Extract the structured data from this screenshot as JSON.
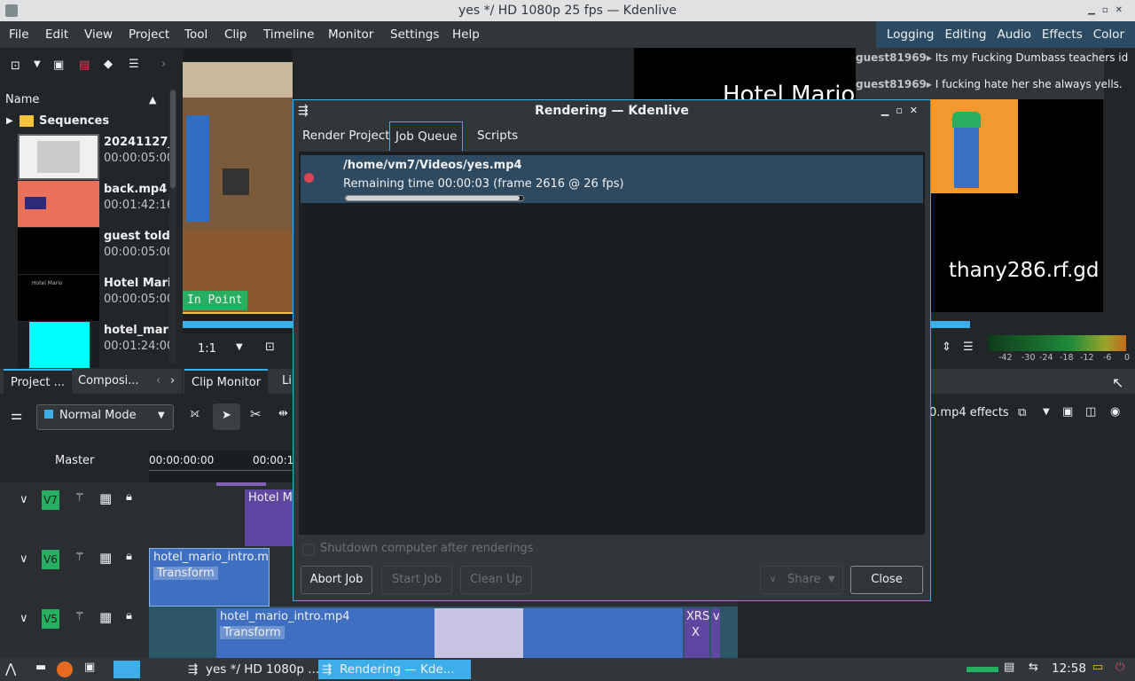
{
  "window": {
    "title": "yes */ HD 1080p 25 fps — Kdenlive"
  },
  "menu": {
    "items": [
      "File",
      "Edit",
      "View",
      "Project",
      "Tool",
      "Clip",
      "Timeline",
      "Monitor",
      "Settings",
      "Help"
    ],
    "layouts": [
      "Logging",
      "Editing",
      "Audio",
      "Effects",
      "Color"
    ]
  },
  "project_bin": {
    "column_header": "Name",
    "folder": "Sequences",
    "items": [
      {
        "name": "20241127_",
        "duration": "00:00:05:00"
      },
      {
        "name": "back.mp4",
        "duration": "00:01:42:16"
      },
      {
        "name": "guest told",
        "duration": "00:00:05:00"
      },
      {
        "name": "Hotel Mari",
        "duration": "00:00:05:00",
        "thumb_text": "Hotel Mario"
      },
      {
        "name": "hotel_mari",
        "duration": "00:01:24:00"
      }
    ],
    "tabs": [
      "Project ...",
      "Composi..."
    ]
  },
  "clip_monitor": {
    "overlay": "In Point",
    "zoom": "1:1",
    "tabs": [
      "Clip Monitor",
      "Li"
    ]
  },
  "project_monitor": {
    "title_text": "Hotel Mario",
    "watermark": "thany286.rf.gd",
    "chat": [
      {
        "user": "guest81969",
        "message": "Its my Fucking Dumbass teachers id"
      },
      {
        "user": "guest81969",
        "message": "I fucking hate her she always yells."
      }
    ]
  },
  "audio_meter": {
    "scale": [
      "-42",
      "-30",
      "-24",
      "-18",
      "-12",
      "-6",
      "0"
    ]
  },
  "effects_panel": {
    "title": "0.mp4 effects"
  },
  "timeline": {
    "mode": "Normal Mode",
    "master_label": "Master",
    "timecodes": [
      "00:00:00:00",
      "00:00:1"
    ],
    "tracks": [
      {
        "id": "V7",
        "clips": [
          {
            "title": "Hotel Ma"
          }
        ]
      },
      {
        "id": "V6",
        "clips": [
          {
            "title": "hotel_mario_intro.mp",
            "effect": "Transform"
          }
        ]
      },
      {
        "id": "V5",
        "clips": [
          {
            "title": "hotel_mario_intro.mp4",
            "effect": "Transform"
          },
          {
            "title": "XRS",
            "sub": "X"
          },
          {
            "title": "v"
          }
        ]
      }
    ]
  },
  "render_dialog": {
    "title": "Rendering — Kdenlive",
    "tabs": [
      "Render Project",
      "Job Queue",
      "Scripts"
    ],
    "active_tab": "Job Queue",
    "job": {
      "path": "/home/vm7/Videos/yes.mp4",
      "status": "Remaining time 00:00:03 (frame 2616 @ 26 fps)",
      "progress": 0.98
    },
    "shutdown_label": "Shutdown computer after renderings",
    "buttons": {
      "abort": "Abort Job",
      "start": "Start Job",
      "cleanup": "Clean Up",
      "share": "Share",
      "close": "Close"
    }
  },
  "taskbar": {
    "tasks": [
      "yes */ HD 1080p ...",
      "Rendering — Kde..."
    ],
    "clock": "12:58"
  },
  "colors": {
    "accent": "#3daee9",
    "job_highlight": "#2d4a61",
    "badge_green": "#27ae60",
    "recording_red": "#da4453"
  }
}
